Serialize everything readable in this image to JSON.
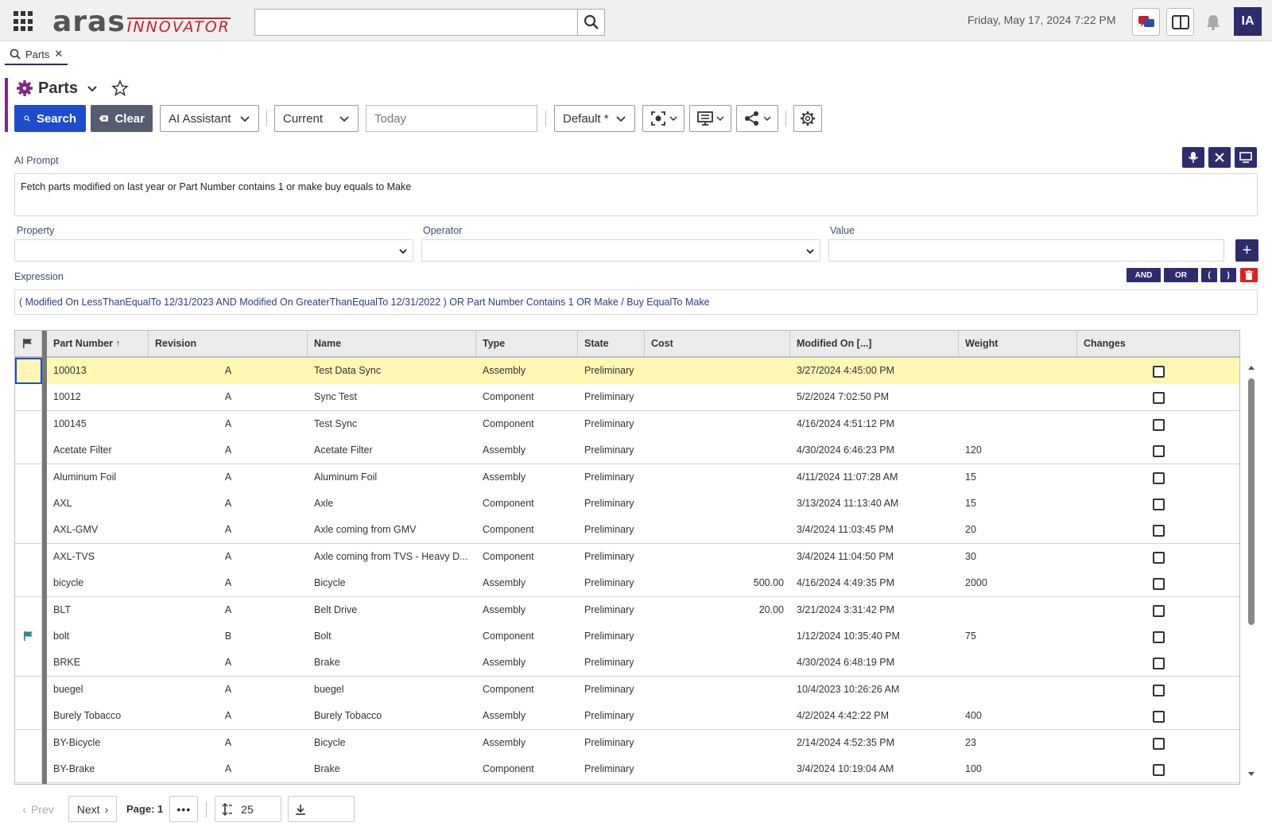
{
  "header": {
    "logo_aras": "aras",
    "logo_innovator": "INNOVATOR",
    "search_placeholder": "",
    "datetime": "Friday, May 17, 2024 7:22 PM",
    "avatar_initials": "IA"
  },
  "tabs": [
    {
      "label": "Parts"
    }
  ],
  "page": {
    "title": "Parts"
  },
  "toolbar": {
    "search_label": "Search",
    "clear_label": "Clear",
    "ai_assistant_label": "AI Assistant",
    "current_label": "Current",
    "date_placeholder": "Today",
    "view_label": "Default *"
  },
  "ai": {
    "prompt_label": "AI Prompt",
    "prompt_text": "Fetch parts modified on last year or Part Number contains 1 or make buy equals to Make"
  },
  "criteria": {
    "property_label": "Property",
    "operator_label": "Operator",
    "value_label": "Value",
    "add_label": "+"
  },
  "expression": {
    "label": "Expression",
    "and_label": "AND",
    "or_label": "OR",
    "open_paren": "(",
    "close_paren": ")",
    "text": "( Modified On LessThanEqualTo 12/31/2023  AND  Modified On GreaterThanEqualTo 12/31/2022  )  OR  Part Number Contains 1  OR  Make / Buy EqualTo Make"
  },
  "grid": {
    "columns": [
      "Part Number",
      "Revision",
      "Name",
      "Type",
      "State",
      "Cost",
      "Modified On [...]",
      "Weight",
      "Changes"
    ],
    "sort_indicator": "↑",
    "rows": [
      {
        "part": "100013",
        "rev": "A",
        "name": "Test Data Sync",
        "type": "Assembly",
        "state": "Preliminary",
        "cost": "",
        "modified": "3/27/2024 4:45:00 PM",
        "weight": "",
        "flag": false
      },
      {
        "part": "10012",
        "rev": "A",
        "name": "Sync Test",
        "type": "Component",
        "state": "Preliminary",
        "cost": "",
        "modified": "5/2/2024 7:02:50 PM",
        "weight": "",
        "flag": false
      },
      {
        "part": "100145",
        "rev": "A",
        "name": "Test Sync",
        "type": "Component",
        "state": "Preliminary",
        "cost": "",
        "modified": "4/16/2024 4:51:12 PM",
        "weight": "",
        "flag": false
      },
      {
        "part": "Acetate Filter",
        "rev": "A",
        "name": "Acetate Filter",
        "type": "Assembly",
        "state": "Preliminary",
        "cost": "",
        "modified": "4/30/2024 6:46:23 PM",
        "weight": "120",
        "flag": false
      },
      {
        "part": "Aluminum Foil",
        "rev": "A",
        "name": "Aluminum Foil",
        "type": "Assembly",
        "state": "Preliminary",
        "cost": "",
        "modified": "4/11/2024 11:07:28 AM",
        "weight": "15",
        "flag": false
      },
      {
        "part": "AXL",
        "rev": "A",
        "name": "Axle",
        "type": "Component",
        "state": "Preliminary",
        "cost": "",
        "modified": "3/13/2024 11:13:40 AM",
        "weight": "15",
        "flag": false
      },
      {
        "part": "AXL-GMV",
        "rev": "A",
        "name": "Axle coming from GMV",
        "type": "Component",
        "state": "Preliminary",
        "cost": "",
        "modified": "3/4/2024 11:03:45 PM",
        "weight": "20",
        "flag": false
      },
      {
        "part": "AXL-TVS",
        "rev": "A",
        "name": "Axle coming from TVS - Heavy D...",
        "type": "Component",
        "state": "Preliminary",
        "cost": "",
        "modified": "3/4/2024 11:04:50 PM",
        "weight": "30",
        "flag": false
      },
      {
        "part": "bicycle",
        "rev": "A",
        "name": "Bicycle",
        "type": "Assembly",
        "state": "Preliminary",
        "cost": "500.00",
        "modified": "4/16/2024 4:49:35 PM",
        "weight": "2000",
        "flag": false
      },
      {
        "part": "BLT",
        "rev": "A",
        "name": "Belt Drive",
        "type": "Assembly",
        "state": "Preliminary",
        "cost": "20.00",
        "modified": "3/21/2024 3:31:42 PM",
        "weight": "",
        "flag": false
      },
      {
        "part": "bolt",
        "rev": "B",
        "name": "Bolt",
        "type": "Component",
        "state": "Preliminary",
        "cost": "",
        "modified": "1/12/2024 10:35:40 PM",
        "weight": "75",
        "flag": true
      },
      {
        "part": "BRKE",
        "rev": "A",
        "name": "Brake",
        "type": "Assembly",
        "state": "Preliminary",
        "cost": "",
        "modified": "4/30/2024 6:48:19 PM",
        "weight": "",
        "flag": false
      },
      {
        "part": "buegel",
        "rev": "A",
        "name": "buegel",
        "type": "Component",
        "state": "Preliminary",
        "cost": "",
        "modified": "10/4/2023 10:26:26 AM",
        "weight": "",
        "flag": false
      },
      {
        "part": "Burely Tobacco",
        "rev": "A",
        "name": "Burely Tobacco",
        "type": "Assembly",
        "state": "Preliminary",
        "cost": "",
        "modified": "4/2/2024 4:42:22 PM",
        "weight": "400",
        "flag": false
      },
      {
        "part": "BY-Bicycle",
        "rev": "A",
        "name": "Bicycle",
        "type": "Assembly",
        "state": "Preliminary",
        "cost": "",
        "modified": "2/14/2024 4:52:35 PM",
        "weight": "23",
        "flag": false
      },
      {
        "part": "BY-Brake",
        "rev": "A",
        "name": "Brake",
        "type": "Component",
        "state": "Preliminary",
        "cost": "",
        "modified": "3/4/2024 10:19:04 AM",
        "weight": "100",
        "flag": false
      }
    ]
  },
  "pager": {
    "prev_label": "Prev",
    "next_label": "Next",
    "page_label": "Page: 1",
    "page_size": "25"
  },
  "colors": {
    "accent": "#2e2b6e",
    "primary_button": "#1d4dcc",
    "selected_row": "#fff7b3",
    "brand_red": "#c4202e"
  }
}
